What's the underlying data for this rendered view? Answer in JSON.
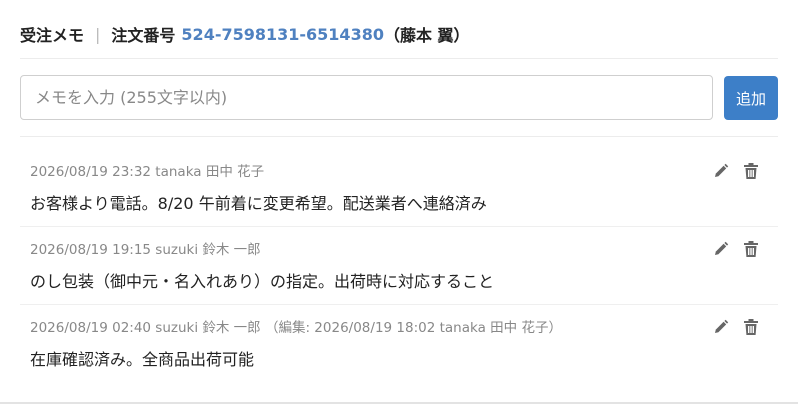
{
  "header": {
    "title": "受注メモ",
    "separator": "|",
    "order_label": "注文番号",
    "order_number": "524-7598131-6514380",
    "customer": "（藤本 翼）"
  },
  "memo_input": {
    "placeholder": "メモを入力 (255文字以内)",
    "value": ""
  },
  "add_button": {
    "label": "追加"
  },
  "memos": [
    {
      "meta": "2026/08/19 23:32 tanaka 田中 花子",
      "text": "お客様より電話。8/20 午前着に変更希望。配送業者へ連絡済み"
    },
    {
      "meta": "2026/08/19 19:15 suzuki 鈴木 一郎",
      "text": "のし包装（御中元・名入れあり）の指定。出荷時に対応すること"
    },
    {
      "meta": "2026/08/19 02:40 suzuki 鈴木 一郎 （編集: 2026/08/19 18:02 tanaka 田中 花子）",
      "text": "在庫確認済み。全商品出荷可能"
    }
  ],
  "icons": {
    "edit": "pencil-icon",
    "delete": "trash-icon"
  },
  "colors": {
    "accent": "#3d7fc8",
    "order_number": "#4f81c0",
    "meta_text": "#888888",
    "icon": "#666666"
  }
}
